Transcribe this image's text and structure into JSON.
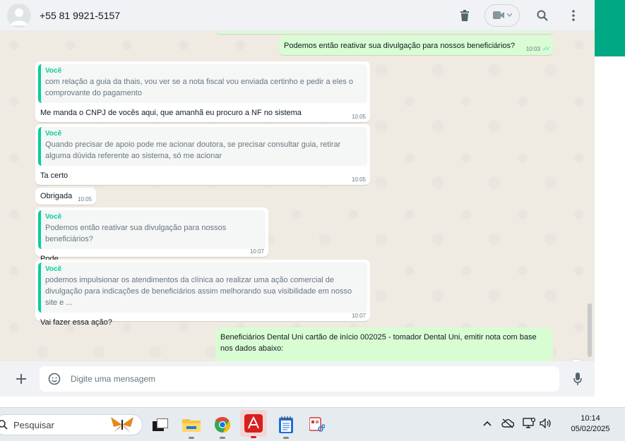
{
  "header": {
    "contact": "+55 81 9921-5157",
    "icons": [
      "trash-icon",
      "video-call-icon",
      "search-icon",
      "menu-icon"
    ]
  },
  "messages": [
    {
      "direction": "out",
      "text": "Podemos então reativar sua divulgação para nossos beneficiários?",
      "time": "10:03",
      "status": "read"
    },
    {
      "direction": "in",
      "quote_author": "Você",
      "quote": "com relação a guia da thais, vou ver se a nota fiscal vou enviada certinho e pedir a eles o comprovante do pagamento",
      "text": "Me manda o CNPJ de vocês aqui, que amanhã eu procuro a NF no sistema",
      "time": "10:05"
    },
    {
      "direction": "in",
      "quote_author": "Você",
      "quote": "Quando precisar de apoio pode me acionar doutora, se precisar consultar guia, retirar alguma dúvida referente ao sistema, só me acionar",
      "text": "Ta certo",
      "time": "10:05"
    },
    {
      "direction": "in",
      "text": "Obrigada",
      "time": "10:05"
    },
    {
      "direction": "in",
      "quote_author": "Você",
      "quote": "Podemos então reativar sua divulgação para nossos beneficiários?",
      "text": "Pode",
      "time": "10:07"
    },
    {
      "direction": "in",
      "quote_author": "Você",
      "quote": "podemos impulsionar os atendimentos da clínica ao realizar uma ação comercial de divulgação para indicações de beneficiários assim melhorando sua visibilidade em nosso site e ...",
      "text": "Vai fazer essa ação?",
      "time": "10:07"
    },
    {
      "direction": "out",
      "text": "Beneficiários Dental Uni cartão de início 002025 - tomador Dental Uni, emitir nota com base nos dados abaixo:"
    }
  ],
  "composer": {
    "placeholder": "Digite uma mensagem"
  },
  "taskbar": {
    "search_placeholder": "Pesquisar",
    "apps": [
      "task-view-icon",
      "file-explorer-icon",
      "chrome-icon",
      "pdf-reader-icon",
      "notepad-icon",
      "snipping-tool-icon"
    ],
    "time": "10:14",
    "date": "05/02/2025"
  },
  "colors": {
    "accent": "#00a884",
    "outgoing_bubble": "#d9fdd3",
    "quote_bar": "#06cf9c",
    "chat_bg": "#efeae2"
  }
}
